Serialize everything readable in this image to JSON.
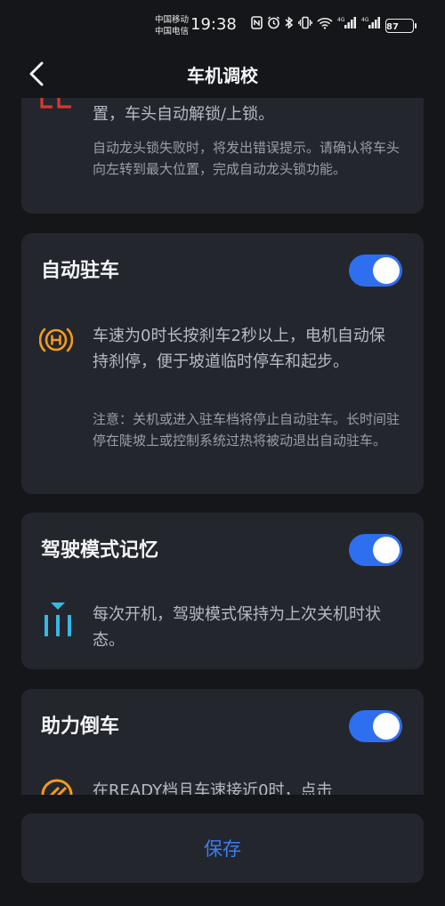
{
  "status_bar": {
    "carrier_1": "中国移动",
    "carrier_2": "中国电信",
    "time": "19:38",
    "battery": "87"
  },
  "header": {
    "title": "车机调校",
    "back_icon": "chevron-left-icon"
  },
  "cards": {
    "steering_lock": {
      "desc_tail": "置，车头自动解锁/上锁。",
      "note": "自动龙头锁失败时，将发出错误提示。请确认将车头向左转到最大位置，完成自动龙头锁功能。",
      "icon": "steering-lock-icon"
    },
    "auto_hold": {
      "title": "自动驻车",
      "enabled": true,
      "desc": "车速为0时长按刹车2秒以上，电机自动保持刹停，便于坡道临时停车和起步。",
      "note": "注意：关机或进入驻车档将停止自动驻车。长时间驻停在陡坡上或控制系统过热将被动退出自动驻车。",
      "icon": "auto-hold-icon",
      "icon_color": "#f39a1e"
    },
    "mode_memory": {
      "title": "驾驶模式记忆",
      "enabled": true,
      "desc": "每次开机，驾驶模式保持为上次关机时状态。",
      "icon": "drive-mode-icon",
      "icon_color": "#35b8e8"
    },
    "reverse_assist": {
      "title": "助力倒车",
      "enabled": true,
      "desc": "在READY档且车速接近0时，点击",
      "icon": "reverse-assist-icon",
      "icon_color": "#f39a1e"
    }
  },
  "save_button": {
    "label": "保存"
  },
  "colors": {
    "background": "#15161a",
    "card": "#23262d",
    "accent": "#2e6ff0",
    "save_text": "#3b7cf5"
  }
}
